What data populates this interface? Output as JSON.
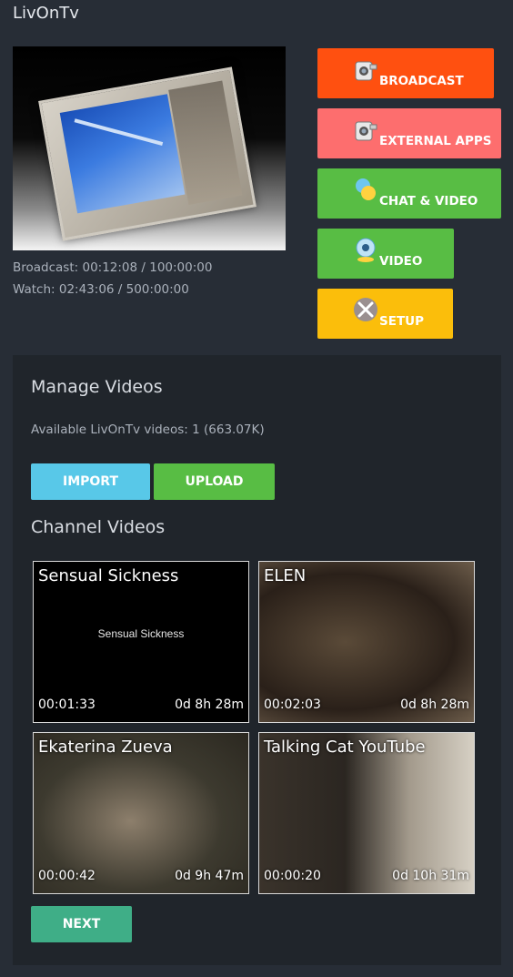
{
  "app": {
    "title": "LivOnTv"
  },
  "stats": {
    "broadcast": "Broadcast: 00:12:08 / 100:00:00",
    "watch": "Watch: 02:43:06 / 500:00:00"
  },
  "actions": [
    {
      "label": "BROADCAST",
      "icon": "camcorder-icon",
      "color": "#ff5010"
    },
    {
      "label": "EXTERNAL APPS",
      "icon": "camcorder-icon",
      "color": "#fd6e6e"
    },
    {
      "label": "CHAT & VIDEO",
      "icon": "chat-users-icon",
      "color": "#58bd44"
    },
    {
      "label": "VIDEO",
      "icon": "webcam-icon",
      "color": "#58bd44"
    },
    {
      "label": "SETUP",
      "icon": "tools-icon",
      "color": "#fbbe0b"
    }
  ],
  "manage": {
    "heading": "Manage Videos",
    "available": "Available LivOnTv videos: 1 (663.07K)",
    "import_label": "IMPORT",
    "upload_label": "UPLOAD"
  },
  "channel": {
    "heading": "Channel Videos",
    "videos": [
      {
        "title": "Sensual Sickness",
        "caption": "Sensual Sickness",
        "duration": "00:01:33",
        "age": "0d 8h 28m"
      },
      {
        "title": "ELEN",
        "duration": "00:02:03",
        "age": "0d 8h 28m"
      },
      {
        "title": "Ekaterina Zueva",
        "duration": "00:00:42",
        "age": "0d 9h 47m"
      },
      {
        "title": "Talking Cat YouTube",
        "duration": "00:00:20",
        "age": "0d 10h 31m"
      }
    ],
    "next_label": "NEXT"
  }
}
